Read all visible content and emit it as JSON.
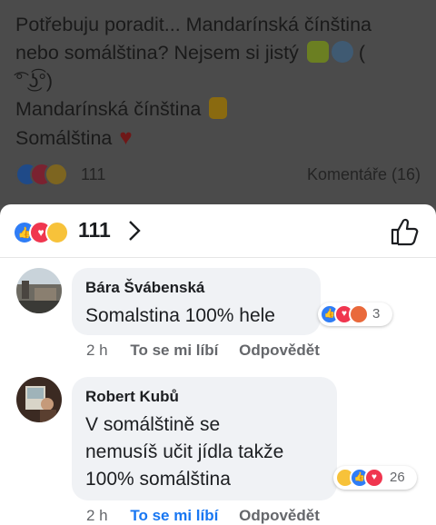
{
  "post": {
    "lines": [
      "Potřebuju poradit... Mandarínská čínština",
      "nebo somálština? Nejsem si jistý",
      "͡° ͜ʖ͡°)",
      "Mandarínská čínština",
      "Somálština"
    ],
    "lenny_start": "(",
    "reaction_count": "111",
    "comments_label": "Komentáře (16)"
  },
  "sheet": {
    "reaction_count": "111"
  },
  "comments": [
    {
      "author": "Bára Švábenská",
      "text_lines": [
        "Somalstina 100% hele"
      ],
      "reaction_count": "3",
      "time": "2 h",
      "like_label": "To se mi líbí",
      "reply_label": "Odpovědět"
    },
    {
      "author": "Robert Kubů",
      "text_lines": [
        "V somálštině se",
        "nemusíš učit jídla takže",
        "100% somálština"
      ],
      "reaction_count": "26",
      "time": "2 h",
      "like_label": "To se mi líbí",
      "reply_label": "Odpovědět"
    }
  ],
  "colors": {
    "like": "#2f7df6",
    "love": "#f0364f",
    "haha": "#f7c23a",
    "angry": "#e9693b",
    "liked_text": "#1877f2"
  }
}
